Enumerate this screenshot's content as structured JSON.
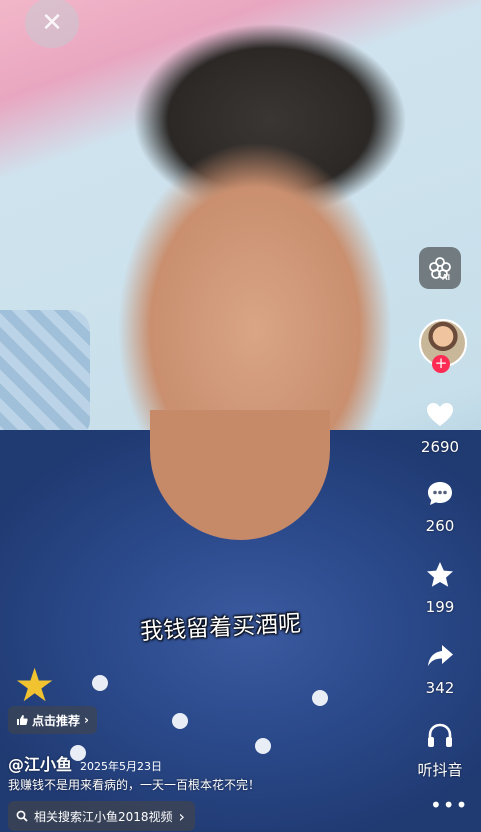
{
  "close": {
    "glyph": "✕"
  },
  "subtitle": "我钱留着买酒呢",
  "actions": {
    "likes": "2690",
    "comments": "260",
    "favorites": "199",
    "shares": "342",
    "listen_label": "听抖音",
    "more": "•••",
    "follow_glyph": "+"
  },
  "recommend": {
    "label": "点击推荐",
    "chevron": "›"
  },
  "post": {
    "author": "@江小鱼",
    "date": "2025年5月23日",
    "description": "我赚钱不是用来看病的，一天一百根本花不完！"
  },
  "related_search": {
    "label": "相关搜索江小鱼2018视频",
    "chevron": "›"
  },
  "colors": {
    "accent": "#fe2c55",
    "text": "#ffffff"
  }
}
